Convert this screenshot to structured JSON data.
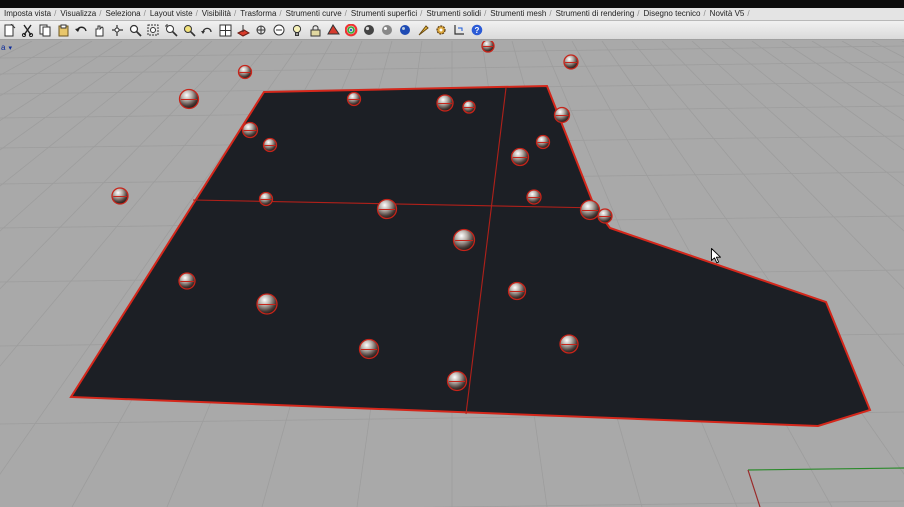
{
  "menu_tabs": [
    "Imposta vista",
    "Visualizza",
    "Seleziona",
    "Layout viste",
    "Visibilità",
    "Trasforma",
    "Strumenti curve",
    "Strumenti superfici",
    "Strumenti solidi",
    "Strumenti mesh",
    "Strumenti di rendering",
    "Disegno tecnico",
    "Novità V5"
  ],
  "toolbar_icons": [
    "new-document-icon",
    "cut-icon",
    "copy-icon",
    "paste-icon",
    "undo-icon",
    "pan-hand-icon",
    "rotate-view-icon",
    "zoom-icon",
    "zoom-window-icon",
    "zoom-extents-icon",
    "zoom-selected-icon",
    "undo-view-icon",
    "four-viewports-icon",
    "cplane-icon",
    "osnap-icon",
    "grid-icon",
    "light-bulb-icon",
    "lock-icon",
    "render-color-icon",
    "color-wheel-icon",
    "material-sphere-icon",
    "render-preview-icon",
    "render-icon",
    "move-icon",
    "gear-options-icon",
    "dimension-icon",
    "help-icon"
  ],
  "viewport": {
    "label": "a",
    "background": "#a9a9a9",
    "surface_fill": "#1c1f25",
    "edge_color": "#d4271b",
    "control_point_count": 27
  }
}
